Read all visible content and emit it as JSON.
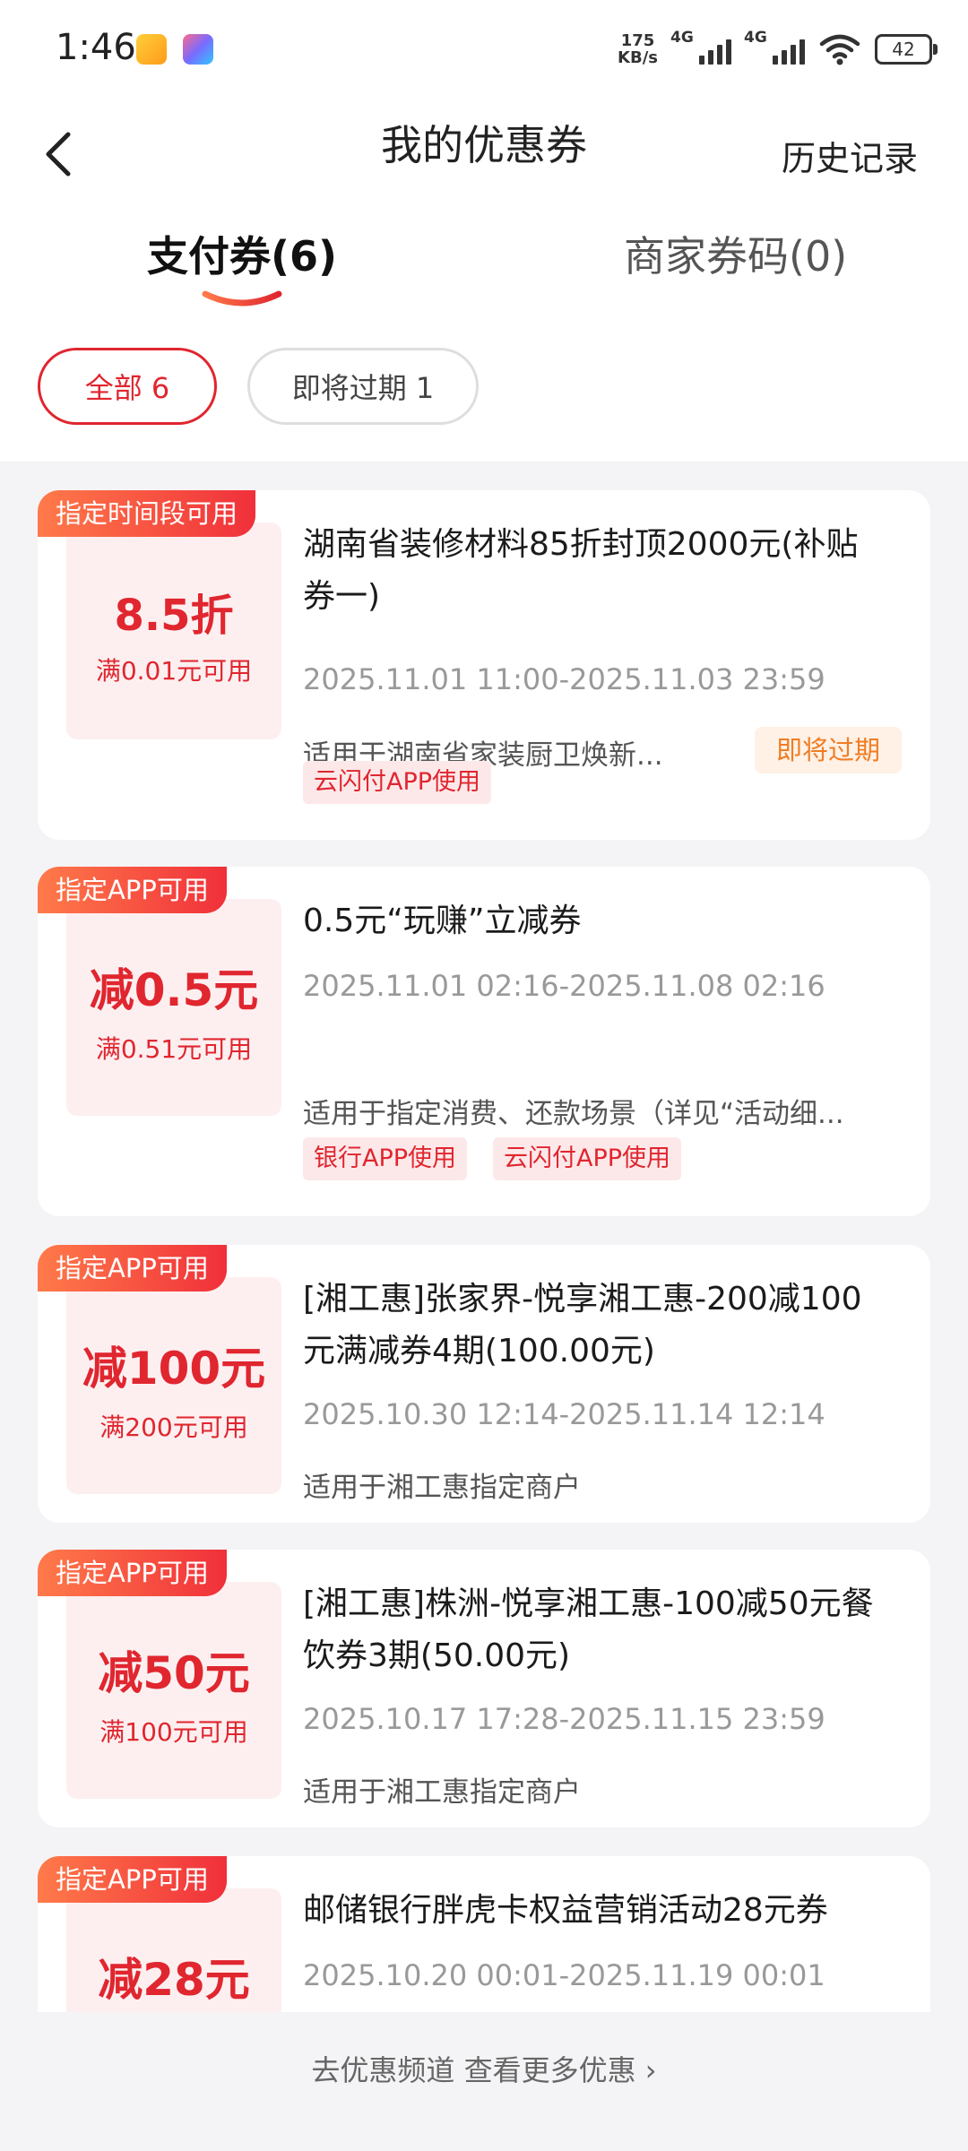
{
  "status_bar": {
    "time": "1:46",
    "speed_value": "175",
    "speed_unit": "KB/s",
    "network1": "4G",
    "network2": "4G",
    "battery": "42"
  },
  "header": {
    "title": "我的优惠券",
    "history": "历史记录"
  },
  "tabs": [
    {
      "label": "支付券(6)",
      "active": true
    },
    {
      "label": "商家券码(0)",
      "active": false
    }
  ],
  "filters": [
    {
      "label": "全部 6",
      "active": true
    },
    {
      "label": "即将过期 1",
      "active": false
    }
  ],
  "coupons": [
    {
      "tag": "指定时间段可用",
      "amount": "8.5折",
      "condition": "满0.01元可用",
      "title": "湖南省装修材料85折封顶2000元(补贴券一)",
      "date": "2025.11.01 11:00-2025.11.03 23:59",
      "desc": "适用于湖南省家装厨卫焕新...",
      "status": "即将过期",
      "pills": [
        "云闪付APP使用"
      ]
    },
    {
      "tag": "指定APP可用",
      "amount": "减0.5元",
      "condition": "满0.51元可用",
      "title": "0.5元“玩赚”立减券",
      "date": "2025.11.01 02:16-2025.11.08 02:16",
      "desc": "适用于指定消费、还款场景（详见“活动细...",
      "pills": [
        "银行APP使用",
        "云闪付APP使用"
      ]
    },
    {
      "tag": "指定APP可用",
      "amount": "减100元",
      "condition": "满200元可用",
      "title": "[湘工惠]张家界-悦享湘工惠-200减100元满减券4期(100.00元)",
      "date": "2025.10.30 12:14-2025.11.14 12:14",
      "desc": "适用于湘工惠指定商户"
    },
    {
      "tag": "指定APP可用",
      "amount": "减50元",
      "condition": "满100元可用",
      "title": "[湘工惠]株洲-悦享湘工惠-100减50元餐饮券3期(50.00元)",
      "date": "2025.10.17 17:28-2025.11.15 23:59",
      "desc": "适用于湘工惠指定商户"
    },
    {
      "tag": "指定APP可用",
      "amount": "减28元",
      "title": "邮储银行胖虎卡权益营销活动28元券",
      "date": "2025.10.20 00:01-2025.11.19 00:01"
    }
  ],
  "footer": {
    "more_link": "去优惠频道 查看更多优惠 ›"
  },
  "colors": {
    "accent": "#e0262f",
    "warning": "#f07d24",
    "background": "#f4f4f6"
  }
}
